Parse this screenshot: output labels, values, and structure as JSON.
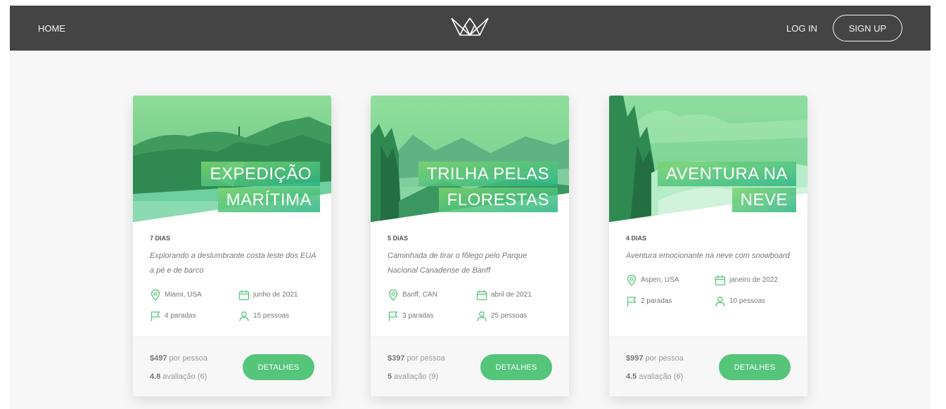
{
  "header": {
    "home_label": "HOME",
    "login_label": "LOG IN",
    "signup_label": "SIGN UP"
  },
  "icons": {
    "logo": "crown-logo",
    "location": "map-pin-icon",
    "date": "calendar-icon",
    "stops": "flag-icon",
    "people": "user-icon"
  },
  "colors": {
    "header_bg": "#444444",
    "accent": "#55c57a",
    "page_bg": "#f7f7f7"
  },
  "cards": [
    {
      "heading_line1": "EXPEDIÇÃO",
      "heading_line2": "MARÍTIMA",
      "duration": "7 DIAS",
      "description": "Explorando a deslumbrante costa leste dos EUA a pé e de barco",
      "location": "Miami, USA",
      "date": "junho de 2021",
      "stops": "4 paradas",
      "people": "15 pessoas",
      "price_value": "$497",
      "price_unit": "por pessoa",
      "rating_value": "4.8",
      "rating_text": "avaliação (6)",
      "button_label": "DETALHES"
    },
    {
      "heading_line1": "TRILHA PELAS",
      "heading_line2": "FLORESTAS",
      "duration": "5 DIAS",
      "description": "Caminhada de tirar o fôlego pelo Parque Nacional Canadense de Banff",
      "location": "Banff, CAN",
      "date": "abril de 2021",
      "stops": "3 paradas",
      "people": "25 pessoas",
      "price_value": "$397",
      "price_unit": "por pessoa",
      "rating_value": "5",
      "rating_text": "avaliação (9)",
      "button_label": "DETALHES"
    },
    {
      "heading_line1": "AVENTURA NA",
      "heading_line2": "NEVE",
      "duration": "4 DIAS",
      "description": "Aventura emocionante na neve com snowboard",
      "location": "Aspen, USA",
      "date": "janeiro de 2022",
      "stops": "2 paradas",
      "people": "10 pessoas",
      "price_value": "$997",
      "price_unit": "por pessoa",
      "rating_value": "4.5",
      "rating_text": "avaliação (6)",
      "button_label": "DETALHES"
    }
  ]
}
